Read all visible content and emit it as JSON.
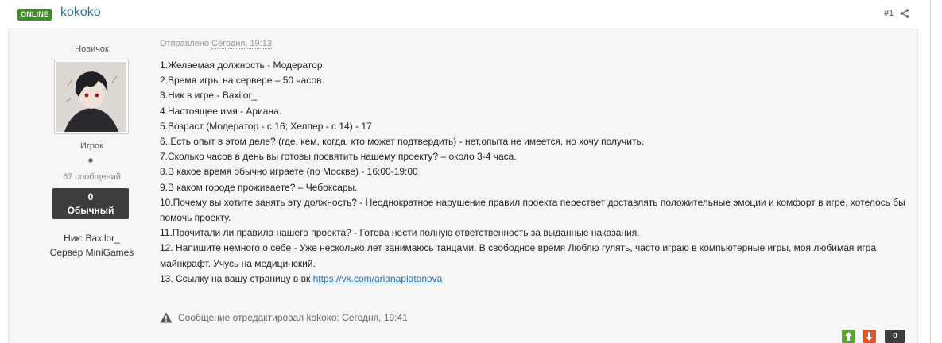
{
  "header": {
    "status_badge": "ONLINE",
    "username": "kokoko",
    "post_number": "#1",
    "share_icon": "share-icon"
  },
  "author": {
    "rank_title": "Новичок",
    "group": "Игрок",
    "posts_count": "67 сообщений",
    "reputation_value": "0",
    "reputation_label": "Обычный",
    "nick_label": "Ник:",
    "nick_value": "Baxilor_",
    "server_label": "Сервер",
    "server_value": "MiniGames"
  },
  "post": {
    "sent_prefix": "Отправлено",
    "sent_date": "Сегодня, 19:13",
    "lines": [
      "1.Желаемая должность - Модератор.",
      "2.Время игры на сервере – 50 часов.",
      "3.Ник в игре - Baxilor_",
      "4.Настоящее имя - Ариана.",
      "5.Возраст (Модератор - с 16; Хелпер - с 14) - 17",
      "6..Есть опыт в этом деле? (где, кем, когда, кто может подтвердить) - нет,опыта не имеется, но хочу получить.",
      "7.Сколько часов в день вы готовы посвятить нашему проекту? – около 3-4 часа.",
      "8.В какое время обычно играете (по Москве) - 16:00-19:00",
      "9.В каком городе проживаете? – Чебоксары.",
      "10.Почему вы хотите занять эту должность? - Неоднократное нарушение правил проекта перестает доставлять положительные эмоции и комфорт в игре, хотелось бы",
      "помочь проекту.",
      "11.Прочитали ли правила нашего проекта? - Готова нести полную ответственность за выданные наказания.",
      "12. Напишите немного о себе - Уже несколько лет занимаюсь танцами. В свободное время Люблю гулять, часто играю в компьютерные игры, моя любимая игра",
      "майнкрафт. Учусь на медицинский."
    ],
    "link_line_prefix": "13. Ссылку на вашу страницу в вк ",
    "link_text": "https://vk.com/arianaplatonova",
    "edit_note": "Сообщение отредактировал kokoko: Сегодня, 19:41"
  },
  "votes": {
    "up_icon": "arrow-up-icon",
    "down_icon": "arrow-down-icon",
    "count": "0",
    "up_color": "#59a32e",
    "down_color": "#e05425"
  },
  "colors": {
    "online_badge": "#3f8d28",
    "username": "#2a6aa3",
    "reputation_bg": "#3d3d3d"
  }
}
